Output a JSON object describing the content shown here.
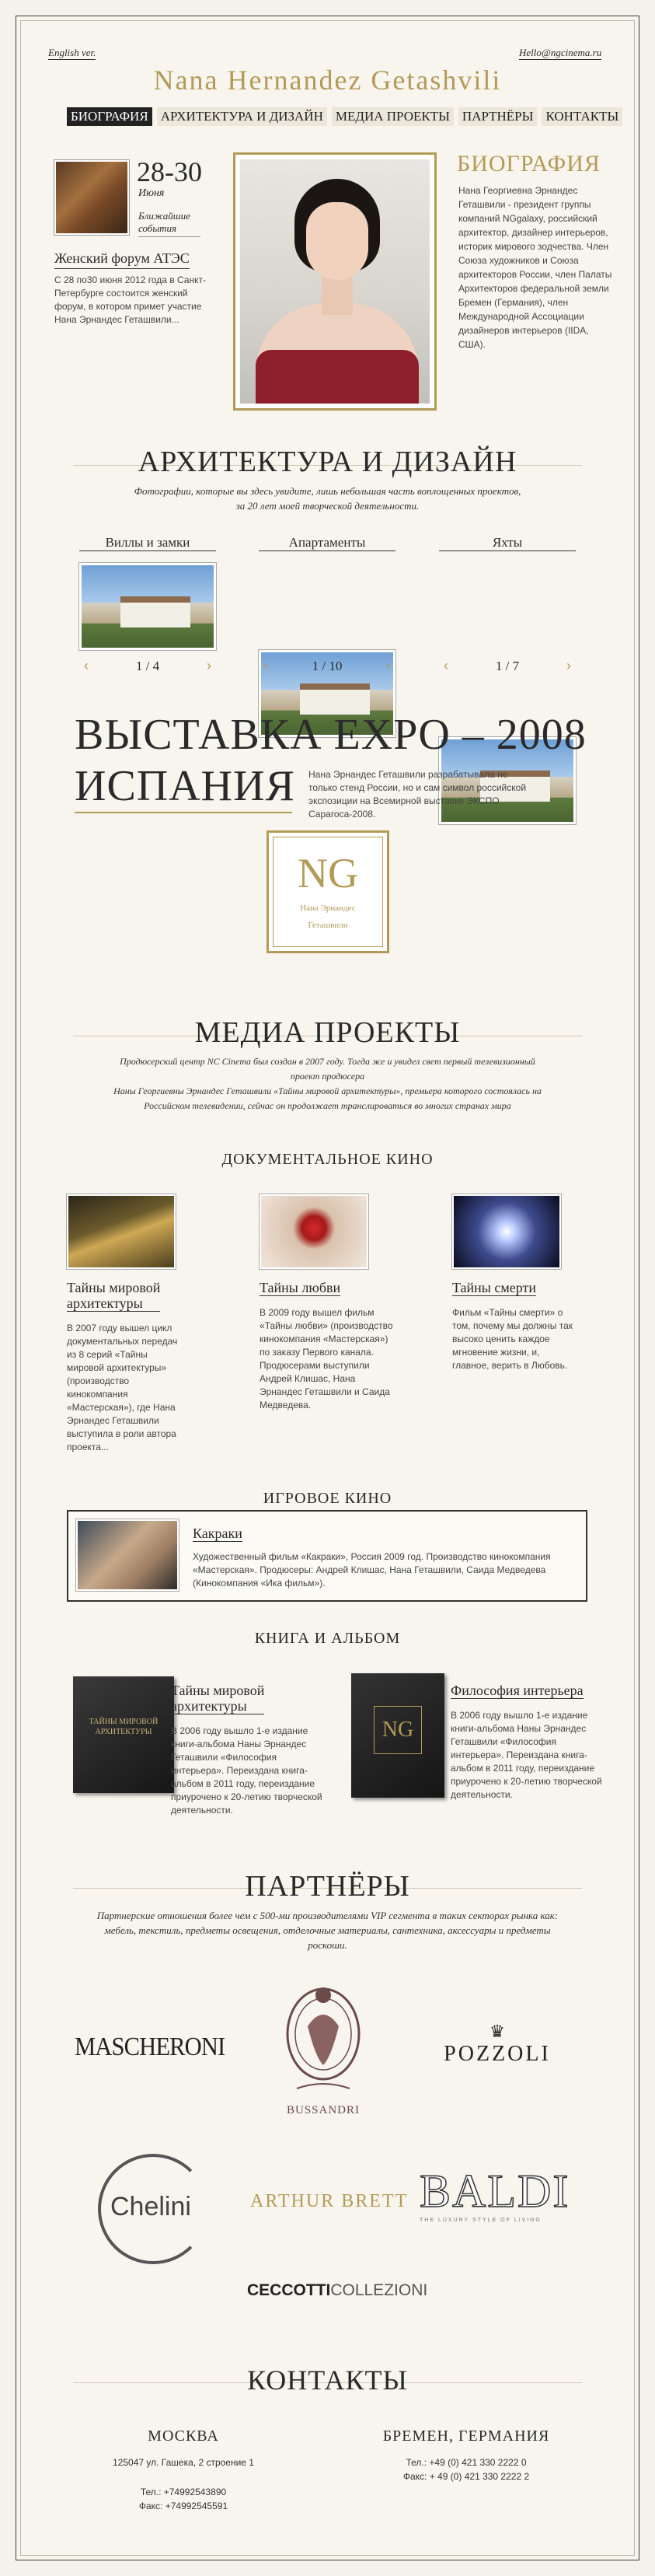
{
  "header": {
    "lang_link": "English ver.",
    "email": "Hello@ngcinema.ru",
    "site_title": "Nana Hernandez Getashvili"
  },
  "nav": [
    {
      "label": "БИОГРАФИЯ",
      "active": true
    },
    {
      "label": "АРХИТЕКТУРА И ДИЗАЙН",
      "active": false
    },
    {
      "label": "МЕДИА ПРОЕКТЫ",
      "active": false
    },
    {
      "label": "ПАРТНЁРЫ",
      "active": false
    },
    {
      "label": "КОНТАКТЫ",
      "active": false
    }
  ],
  "event": {
    "day": "28-30",
    "month": "Июня",
    "note_line1": "Ближайшие",
    "note_line2": "события",
    "title": "Женский форум АТЭС",
    "text": "С 28 по30 июня 2012 года в Санкт-Петербурге состоится женский форум, в котором примет участие Нана Эрнандес Геташвили..."
  },
  "bio": {
    "title": "БИОГРАФИЯ",
    "text": "Нана Георгиевна Эрнандес Геташвили - президент группы компаний NGgalaxy, российский архитектор, дизайнер интерьеров, историк мирового зодчества. Член Союза художников и Союза архитекторов России, член Палаты Архитекторов федеральной земли Бремен (Германия), член Международной Ассоциации дизайнеров интерьеров (IIDA, США)."
  },
  "architecture": {
    "title": "АРХИТЕКТУРА И ДИЗАЙН",
    "sub_line1": "Фотографии, которые вы здесь увидите, лишь небольшая часть воплощенных проектов,",
    "sub_line2": "за 20 лет моей творческой деятельности.",
    "galleries": [
      {
        "label": "Виллы и замки",
        "counter": "1 / 4"
      },
      {
        "label": "Апартаменты",
        "counter": "1 / 10"
      },
      {
        "label": "Яхты",
        "counter": "1 / 7"
      }
    ],
    "prev_arrow": "‹",
    "next_arrow": "›"
  },
  "expo": {
    "title_line1": "ВЫСТАВКА EXPO – 2008",
    "title_line2": "ИСПАНИЯ",
    "text": "Нана Эрнандес Геташвили разрабатывала не только стенд России, но и сам символ российской экспозиции на Всемирной выставке ЭКСПО Сарагоса-2008.",
    "logo_mono": "NG",
    "logo_name_line1": "Нана Эрнандес",
    "logo_name_line2": "Геташвили"
  },
  "media": {
    "title": "МЕДИА ПРОЕКТЫ",
    "sub_line1": "Продюсерский центр NC Cinema был создан в 2007 году. Тогда же и увидел свет первый телевизионный",
    "sub_line2": "проект продюсера",
    "sub_line3": "Наны Георгиевны Эрнандес Геташвили «Тайны мировой архитектуры», премьера которого состоялась на",
    "sub_line4": "Российском телевидении, сейчас он продолжает транслироваться во многих странах мира",
    "doc_title": "ДОКУМЕНТАЛЬНОЕ КИНО",
    "films": [
      {
        "title_line1": "Тайны мировой",
        "title_line2": "архитектуры",
        "text": "В 2007 году вышел цикл документальных передач из 8 серий «Тайны мировой архитектуры» (производство кинокомпания «Мастерская»), где Нана Эрнандес Геташвили выступила в роли автора проекта..."
      },
      {
        "title_line1": "Тайны любви",
        "title_line2": "",
        "text": "В 2009 году вышел фильм «Тайны любви» (производство кинокомпания «Мастерская») по заказу Первого канала. Продюсерами выступили Андрей Клишас, Нана Эрнандес Геташвили и Саида Медведева."
      },
      {
        "title_line1": "Тайны смерти",
        "title_line2": "",
        "text": "Фильм «Тайны смерти» о том, почему мы должны так высоко ценить каждое мгновение жизни, и, главное, верить в Любовь."
      }
    ],
    "feature_title": "ИГРОВОЕ КИНО",
    "feature": {
      "title": "Какраки",
      "text": "Художественный фильм «Какраки», Россия 2009 год. Производство кинокомпания «Мастерская». Продюсеры: Андрей Клишас, Нана Геташвили, Саида Медведева (Кинокомпания «Ика фильм»)."
    },
    "books_title": "КНИГА И АЛЬБОМ",
    "books": [
      {
        "title_line1": "Тайны мировой",
        "title_line2": "архитектуры",
        "text": "В 2006 году вышло 1-е издание книги-альбома Наны Эрнандес Геташвили «Философия интерьера». Переиздана книга-альбом в 2011 году, переиздание приурочено к 20-летию творческой деятельности.",
        "cover_text": "ТАЙНЫ МИРОВОЙ АРХИТЕКТУРЫ"
      },
      {
        "title_line1": "Философия интерьера",
        "title_line2": "",
        "text": "В 2006 году вышло 1-е издание книги-альбома Наны Эрнандес Геташвили «Философия интерьера». Переиздана книга-альбом в 2011 году, переиздание приурочено к 20-летию творческой деятельности.",
        "cover_text": "NG"
      }
    ]
  },
  "partners": {
    "title": "ПАРТНЁРЫ",
    "sub_line1": "Партнерские отношения более чем с 500-ми производителями VIP сегмента в таких секторах рынка как:",
    "sub_line2": "мебель, текстиль, предметы освещения, отделочные материалы, сантехника, аксессуары и предметы",
    "sub_line3": "роскоши.",
    "logos": {
      "mascheroni": "MASCHERONI",
      "bussandri": "BUSSANDRI",
      "pozzoli": "POZZOLI",
      "chelini": "Chelini",
      "arthur_brett": "ARTHUR BRETT",
      "baldi": "BALDI",
      "baldi_tag": "THE LUXURY STYLE OF LIVING",
      "ceccotti_a": "CECCOTTI",
      "ceccotti_b": "COLLEZIONI"
    }
  },
  "contacts": {
    "title": "КОНТАКТЫ",
    "moscow": {
      "city": "МОСКВА",
      "address": "125047  ул. Гашека, 2 строение 1",
      "phone": "Тел.: +74992543890",
      "fax": "Факс: +74992545591"
    },
    "bremen": {
      "city": "БРЕМЕН, ГЕРМАНИЯ",
      "phone": "Тел.: +49 (0) 421 330 2222 0",
      "fax": "Факс: + 49 (0) 421 330 2222 2"
    }
  },
  "colors": {
    "accent_gold": "#b39a57",
    "background": "#f4f2ea",
    "text": "#2a2a2a"
  }
}
